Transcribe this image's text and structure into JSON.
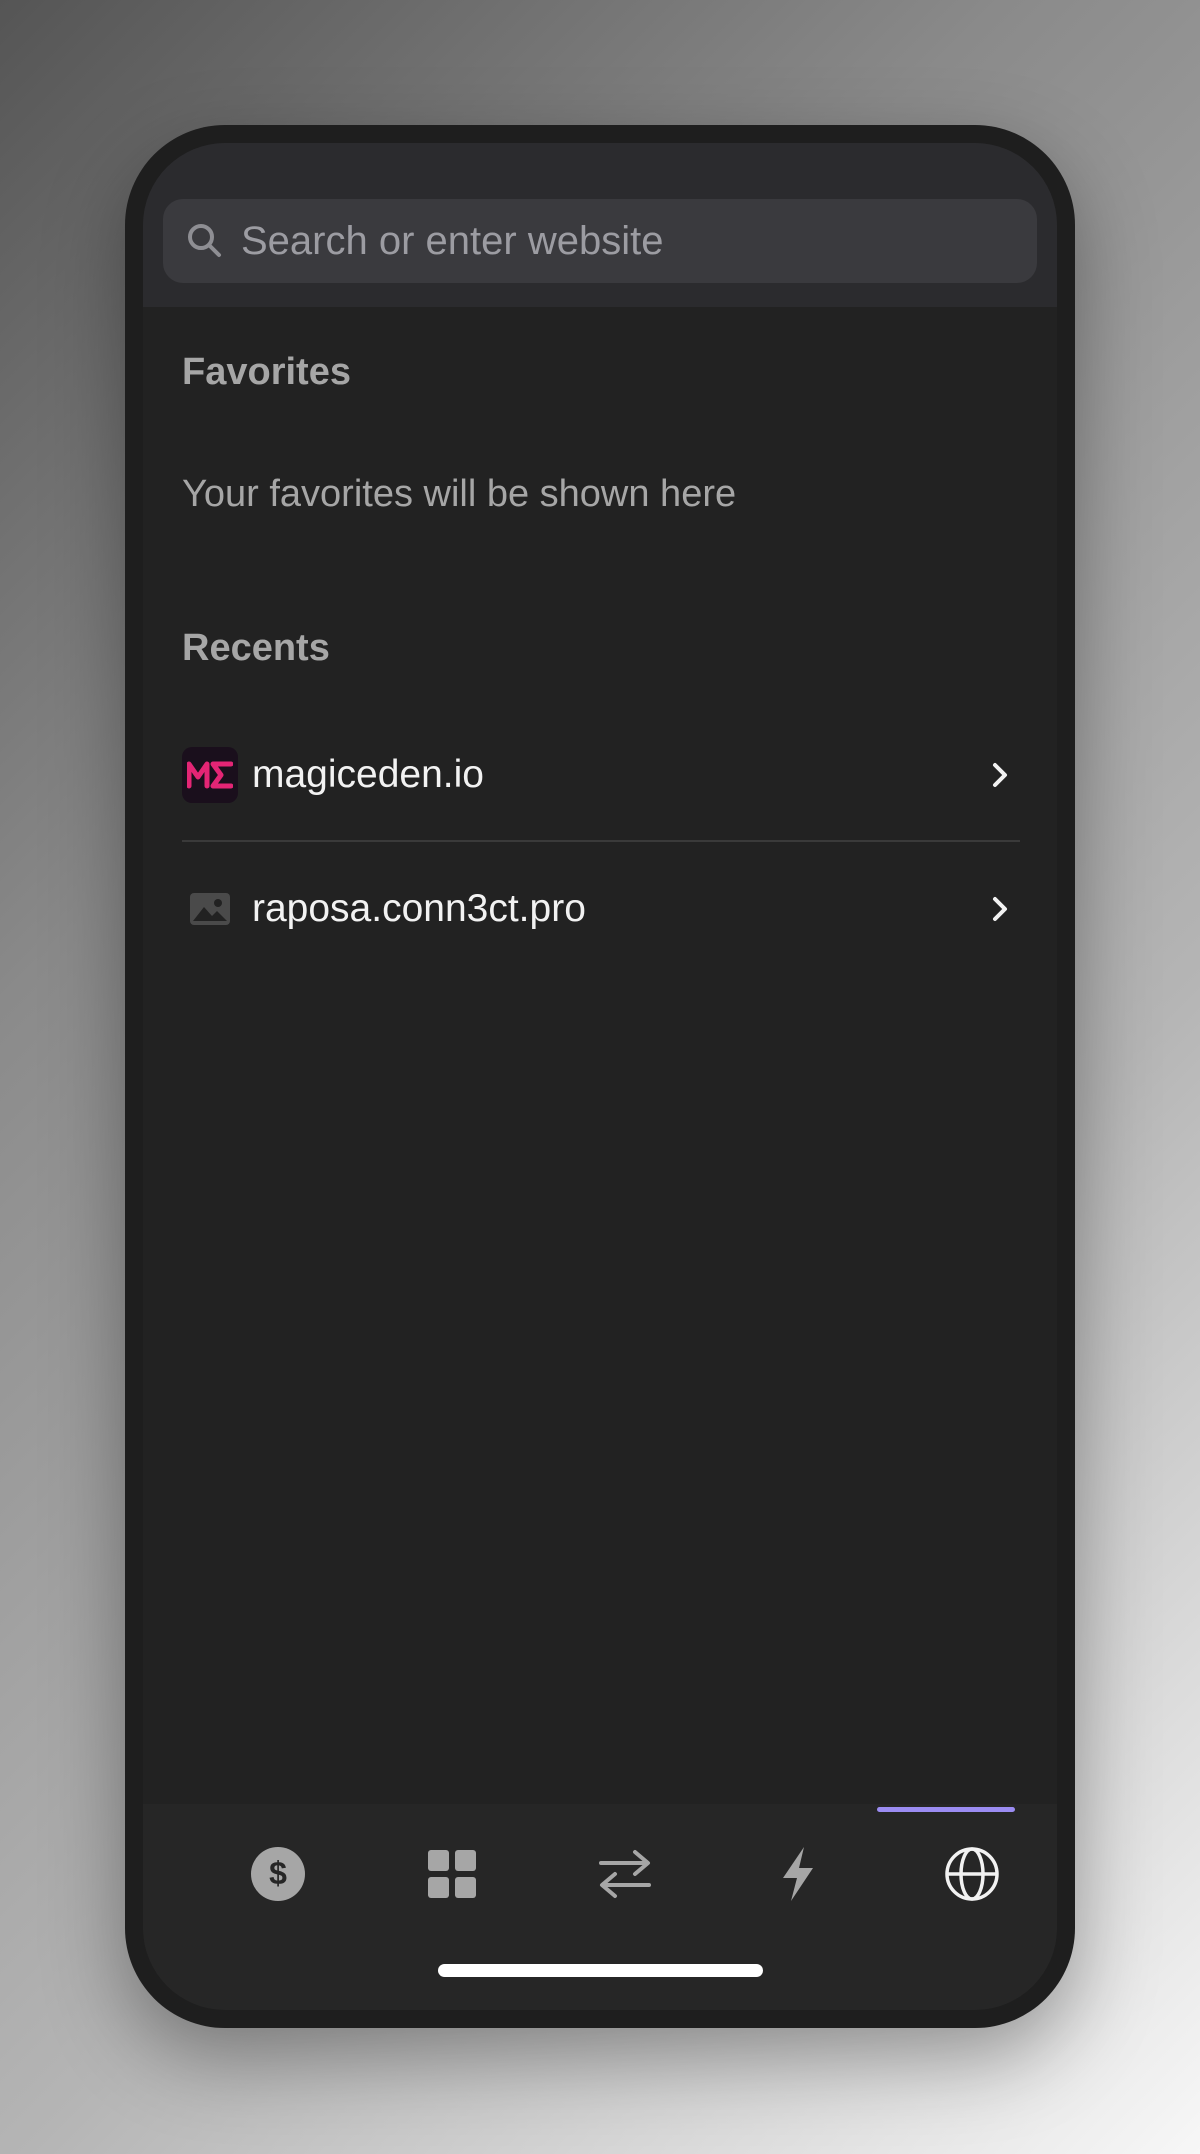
{
  "search": {
    "placeholder": "Search or enter website",
    "icon": "search-icon"
  },
  "favorites": {
    "title": "Favorites",
    "empty_text": "Your favorites will be shown here"
  },
  "recents": {
    "title": "Recents",
    "items": [
      {
        "label": "magiceden.io",
        "icon": "magic-eden-logo-icon"
      },
      {
        "label": "raposa.conn3ct.pro",
        "icon": "image-placeholder-icon"
      }
    ]
  },
  "tabbar": {
    "tabs": [
      {
        "name": "wallet",
        "icon": "dollar-icon"
      },
      {
        "name": "collectibles",
        "icon": "grid-icon"
      },
      {
        "name": "swap",
        "icon": "swap-arrows-icon"
      },
      {
        "name": "activity",
        "icon": "lightning-icon"
      },
      {
        "name": "browser",
        "icon": "globe-icon",
        "active": true
      }
    ]
  },
  "colors": {
    "accent": "#9b8cf2",
    "screen_background": "#222222",
    "header_background": "#2b2b2e",
    "magic_eden_pink": "#e42575"
  }
}
